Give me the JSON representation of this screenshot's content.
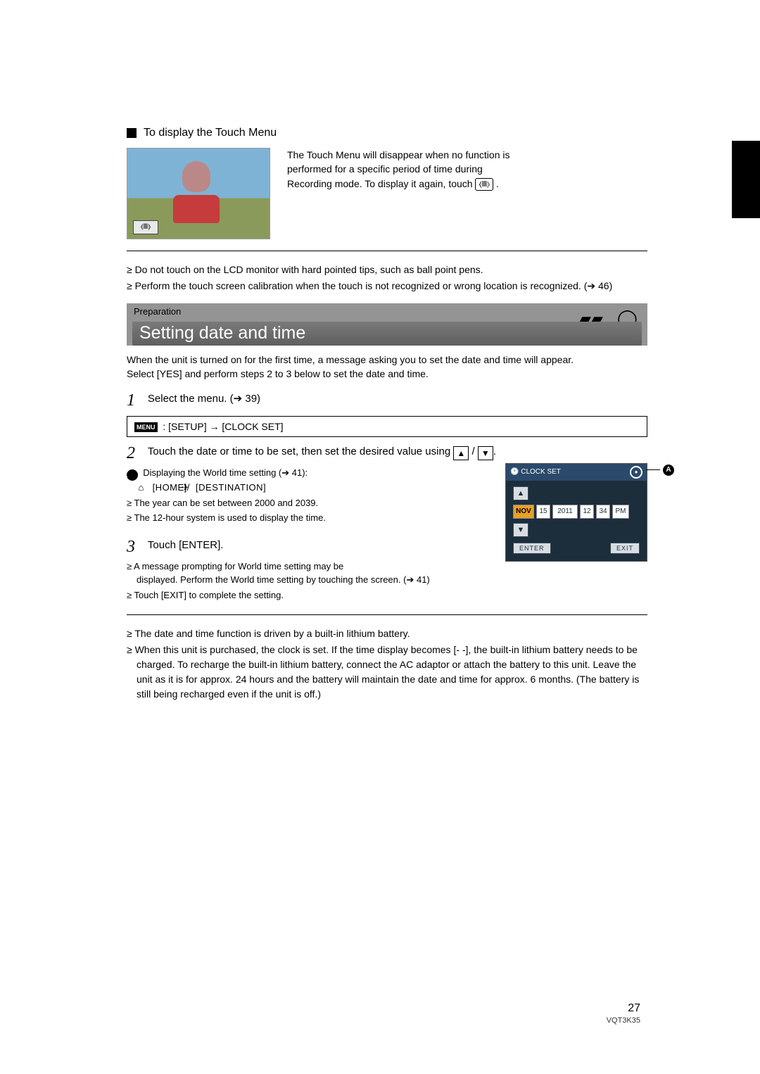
{
  "section1": {
    "title": "To display the Touch Menu",
    "desc_l1": "The Touch Menu will disappear when no function is",
    "desc_l2": "performed for a specific period of time during",
    "desc_l3": "Recording mode. To display it again, touch ",
    "touch_icon": "⦉⦊",
    "warn1": "≥ Do not touch on the LCD monitor with hard pointed tips, such as ball point pens.",
    "warn2a": "≥ Perform the touch screen calibration when the touch is not recognized or wrong location is",
    "warn2b": "recognized. (",
    "warn2c": " 46)"
  },
  "prep": {
    "label": "Preparation",
    "title": "Setting date and time"
  },
  "intro": {
    "l1": "When the unit is turned on for the first time, a message asking you to set the date and time will appear.",
    "l2": "Select [YES] and perform steps 2 to 3 below to set the date and time."
  },
  "step1": {
    "num": "1",
    "text_a": "Select the menu. (",
    "text_b": " 39)",
    "menu_chip": "MENU",
    "menu_path": " : [SETUP] → [CLOCK SET]"
  },
  "step2": {
    "num": "2",
    "text_a": "Touch the date or time to be set, then set the desired value using ",
    "text_b": " / ",
    "text_c": ".",
    "b1a": "Displaying the World time setting (",
    "b1b": " 41):",
    "b1c": " [HOME]/",
    "b1d": " [DESTINATION]",
    "b2": "≥ The year can be set between 2000 and 2039.",
    "b3": "≥ The 12-hour system is used to display the time."
  },
  "clock": {
    "title": "CLOCK SET",
    "month": "NOV",
    "day": "15",
    "year": "2011",
    "hour": "12",
    "min": "34",
    "ampm": "PM",
    "enter": "ENTER",
    "exit": "EXIT",
    "label_a": "A"
  },
  "step3": {
    "num": "3",
    "text": "Touch [ENTER].",
    "b1a": "≥ A message prompting for World time setting may be",
    "b1b": "displayed. Perform the World time setting by touching the screen. (",
    "b1c": " 41)",
    "b2": "≥ Touch [EXIT] to complete the setting."
  },
  "bottom": {
    "b1": "≥ The date and time function is driven by a built-in lithium battery.",
    "b2": "≥ When this unit is purchased, the clock is set. If the time display becomes [- -], the built-in lithium battery needs to be charged. To recharge the built-in lithium battery, connect the AC adaptor or attach the battery to this unit. Leave the unit as it is for approx. 24 hours and the battery will maintain the date and time for approx. 6 months. (The battery is still being recharged even if the unit is off.)"
  },
  "footer": {
    "page": "27",
    "code": "VQT3K35"
  }
}
